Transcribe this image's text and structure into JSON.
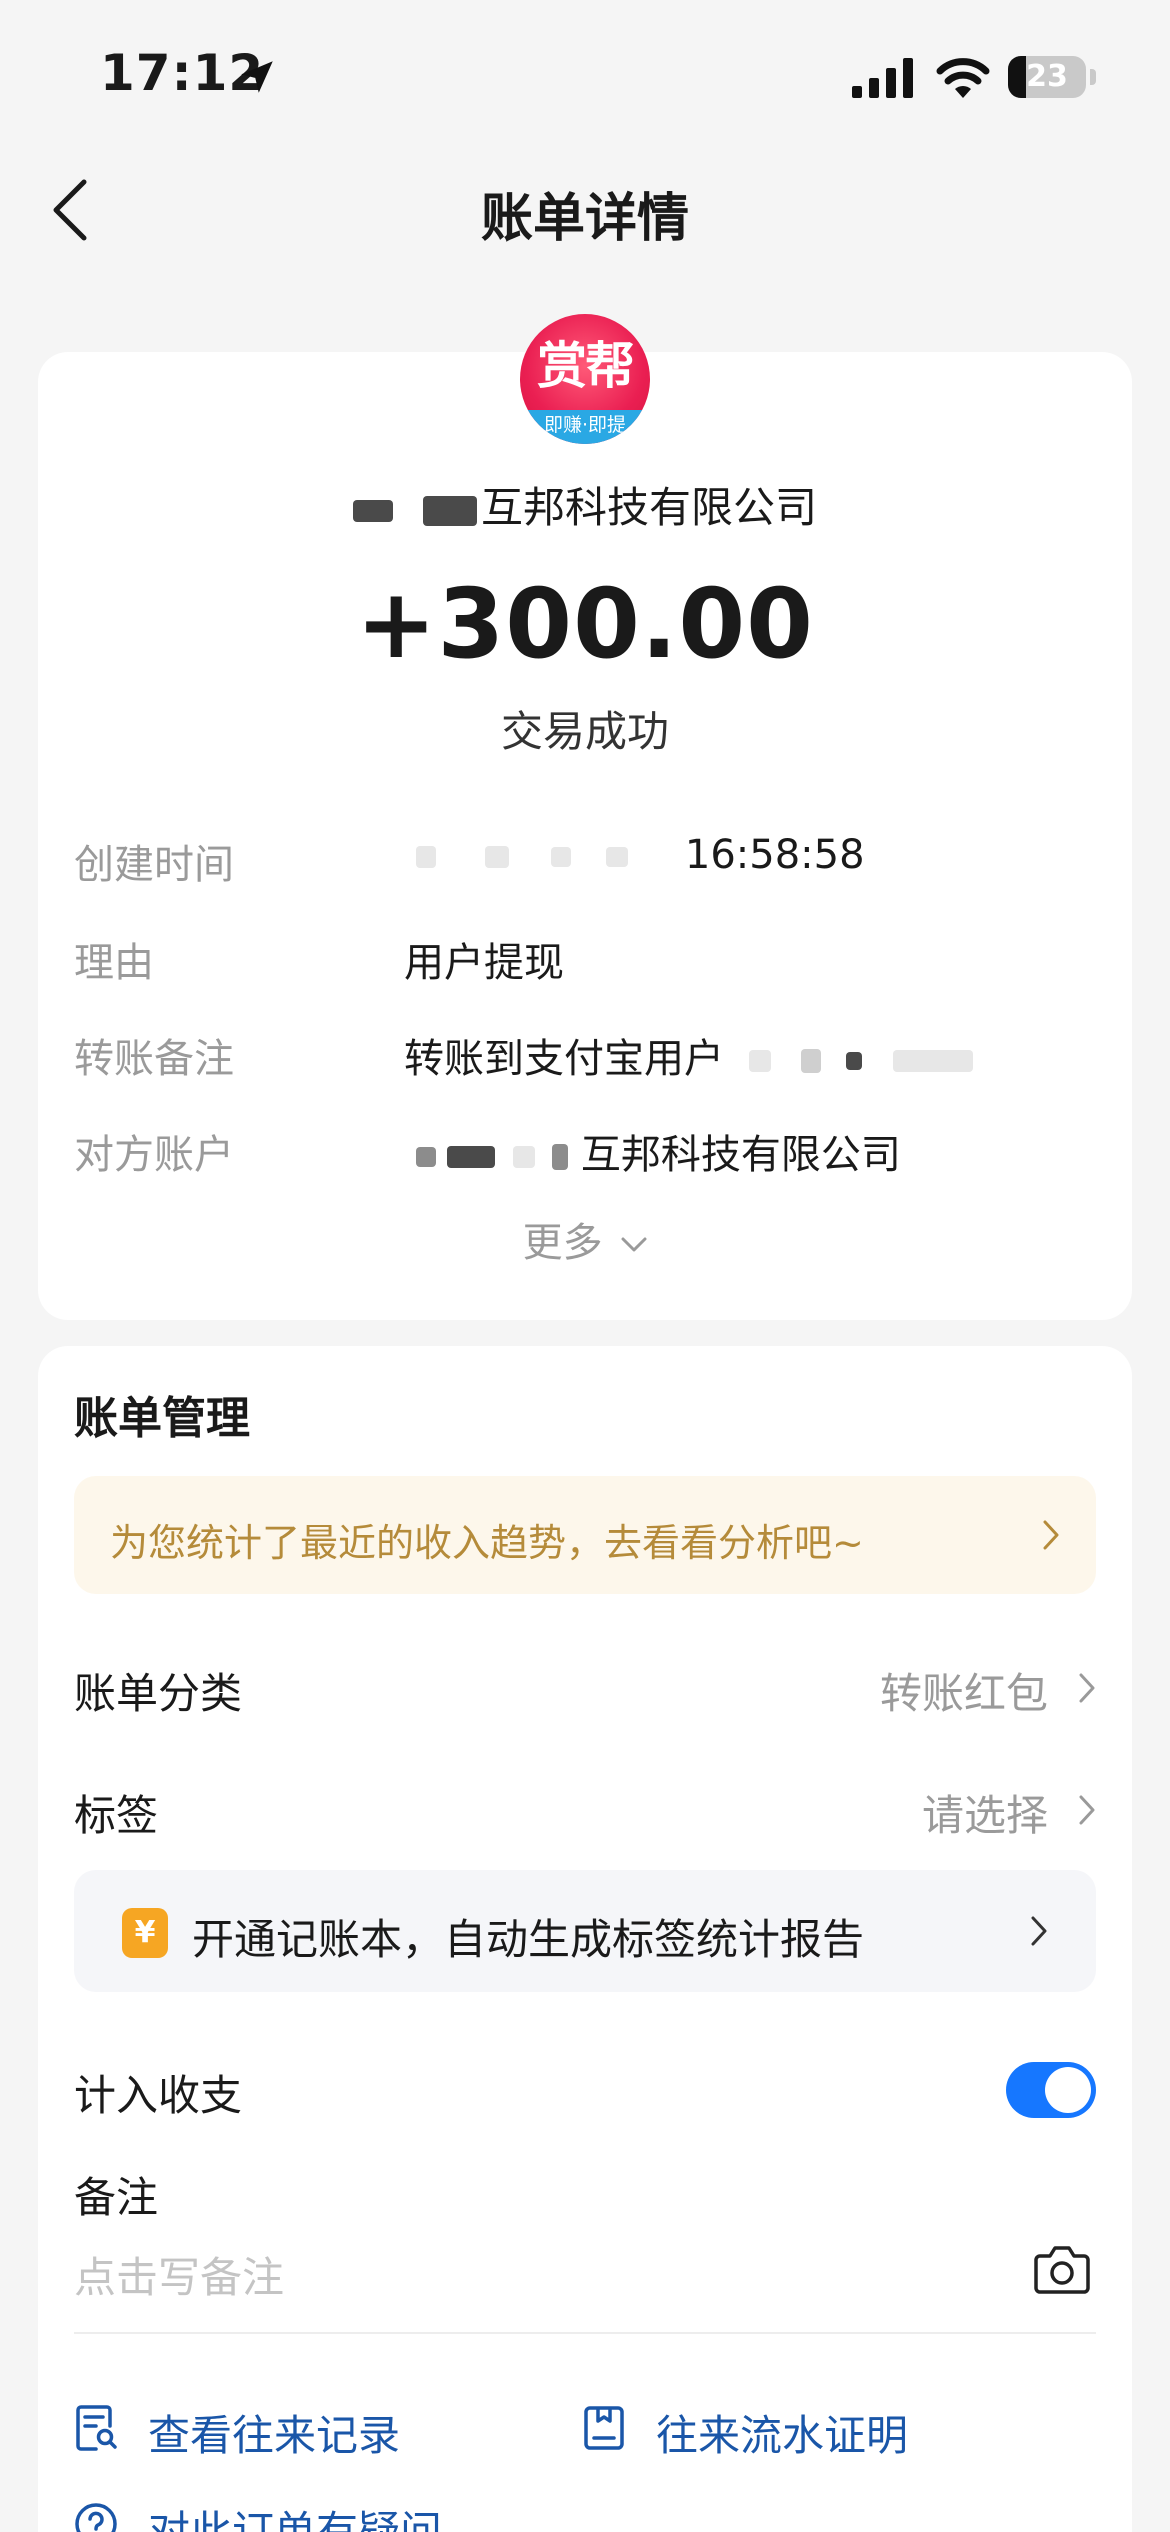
{
  "status_bar": {
    "time": "17:12",
    "battery": "23",
    "battery_fraction": 0.23
  },
  "nav": {
    "title": "账单详情"
  },
  "summary": {
    "avatar_text": "赏帮",
    "avatar_subtext": "即赚·即提",
    "merchant_name": "互邦科技有限公司",
    "amount": "+300.00",
    "status": "交易成功",
    "details": {
      "time_label": "创建时间",
      "time_value": "16:58:58",
      "reason_label": "理由",
      "reason_value": "用户提现",
      "memo_label": "转账备注",
      "memo_value": "转账到支付宝用户",
      "account_label": "对方账户",
      "account_value": "互邦科技有限公司"
    },
    "more": "更多"
  },
  "manage": {
    "title": "账单管理",
    "insight_banner": "为您统计了最近的收入趋势，去看看分析吧~",
    "category_label": "账单分类",
    "category_value": "转账红包",
    "tag_label": "标签",
    "tag_value": "请选择",
    "promo_icon": "¥",
    "promo_text": "开通记账本，自动生成标签统计报告",
    "income_label": "计入收支",
    "income_enabled": true,
    "note_label": "备注",
    "note_placeholder": "点击写备注",
    "link_records": "查看往来记录",
    "link_proof": "往来流水证明",
    "link_question": "对此订单有疑问"
  },
  "colors": {
    "accent_blue": "#1677ff",
    "link_blue": "#1a56a8",
    "banner_text": "#b58b3a",
    "banner_bg": "#fdf7eb",
    "avatar_red": "#ea1f52"
  }
}
